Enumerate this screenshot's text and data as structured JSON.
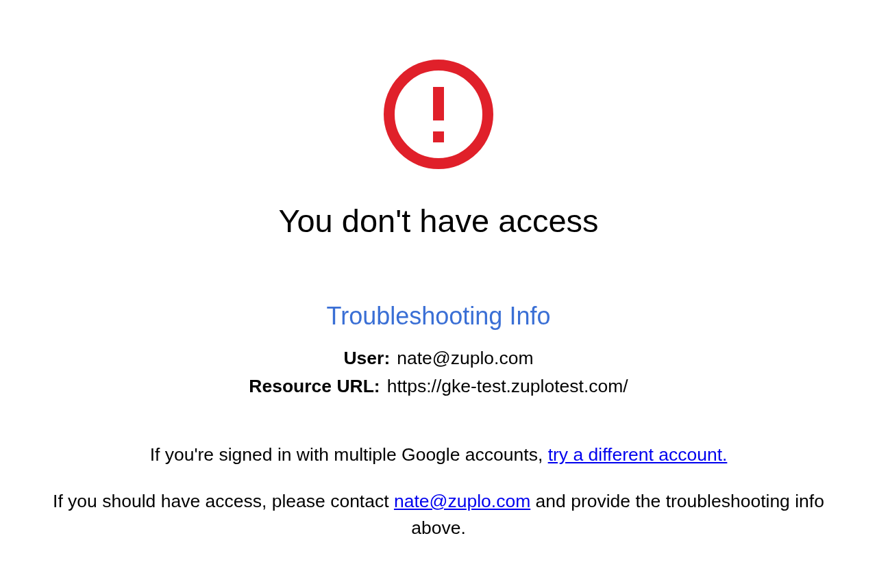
{
  "heading": "You don't have access",
  "troubleshooting": {
    "title": "Troubleshooting Info",
    "fields": [
      {
        "label": "User:",
        "value": "nate@zuplo.com"
      },
      {
        "label": "Resource URL:",
        "value": "https://gke-test.zuplotest.com/"
      }
    ]
  },
  "messages": [
    {
      "parts": [
        {
          "kind": "text",
          "text": "If you're signed in with multiple Google accounts, "
        },
        {
          "kind": "link",
          "text": "try a different account."
        }
      ]
    },
    {
      "parts": [
        {
          "kind": "text",
          "text": "If you should have access, please contact "
        },
        {
          "kind": "link",
          "text": "nate@zuplo.com"
        },
        {
          "kind": "text",
          "text": " and provide the troubleshooting info above."
        }
      ]
    }
  ]
}
